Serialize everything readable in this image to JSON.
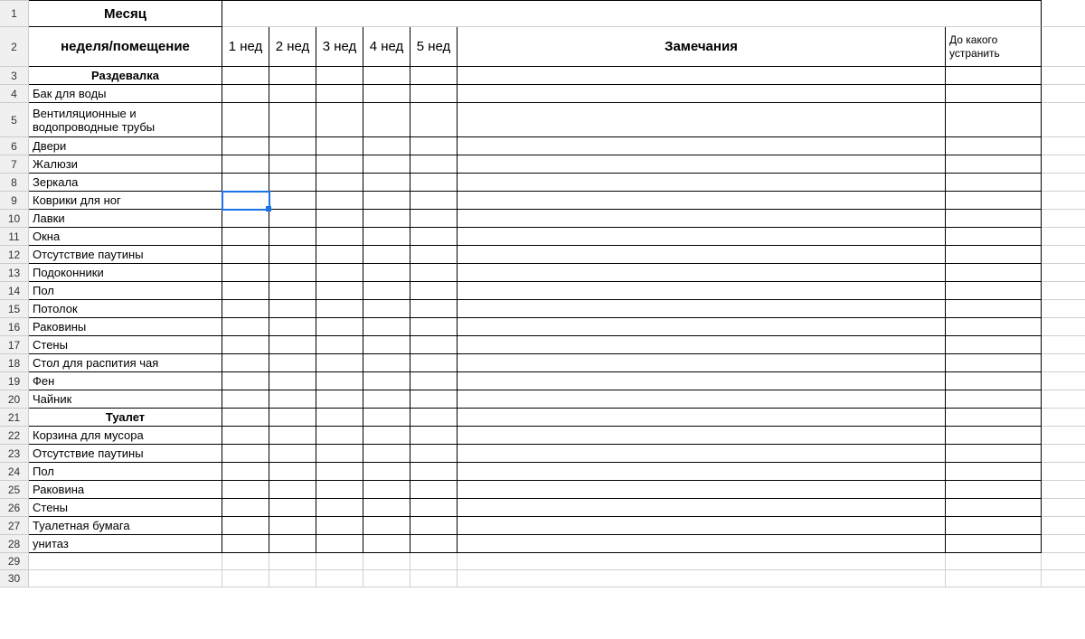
{
  "headers": {
    "month": "Месяц",
    "week_room": "неделя/помещение",
    "weeks": [
      "1 нед",
      "2 нед",
      "3 нед",
      "4 нед",
      "5 нед"
    ],
    "notes": "Замечания",
    "deadline": "До какого устранить"
  },
  "rows": [
    {
      "num": "1"
    },
    {
      "num": "2"
    },
    {
      "num": "3",
      "label": "Раздевалка",
      "section": true
    },
    {
      "num": "4",
      "label": "Бак для воды"
    },
    {
      "num": "5",
      "label": "Вентиляционные и водопроводные трубы",
      "tall": true
    },
    {
      "num": "6",
      "label": "Двери"
    },
    {
      "num": "7",
      "label": "Жалюзи"
    },
    {
      "num": "8",
      "label": "Зеркала"
    },
    {
      "num": "9",
      "label": "Коврики для ног",
      "selected": true
    },
    {
      "num": "10",
      "label": "Лавки"
    },
    {
      "num": "11",
      "label": "Окна"
    },
    {
      "num": "12",
      "label": "Отсутствие паутины"
    },
    {
      "num": "13",
      "label": "Подоконники"
    },
    {
      "num": "14",
      "label": "Пол"
    },
    {
      "num": "15",
      "label": "Потолок"
    },
    {
      "num": "16",
      "label": "Раковины"
    },
    {
      "num": "17",
      "label": "Стены"
    },
    {
      "num": "18",
      "label": "Стол для распития чая"
    },
    {
      "num": "19",
      "label": "Фен"
    },
    {
      "num": "20",
      "label": "Чайник"
    },
    {
      "num": "21",
      "label": "Туалет",
      "section": true
    },
    {
      "num": "22",
      "label": "Корзина для мусора"
    },
    {
      "num": "23",
      "label": "Отсутствие паутины"
    },
    {
      "num": "24",
      "label": "Пол"
    },
    {
      "num": "25",
      "label": "Раковина"
    },
    {
      "num": "26",
      "label": "Стены"
    },
    {
      "num": "27",
      "label": "Туалетная бумага"
    },
    {
      "num": "28",
      "label": "унитаз"
    },
    {
      "num": "29",
      "empty": true
    },
    {
      "num": "30",
      "empty": true
    }
  ]
}
